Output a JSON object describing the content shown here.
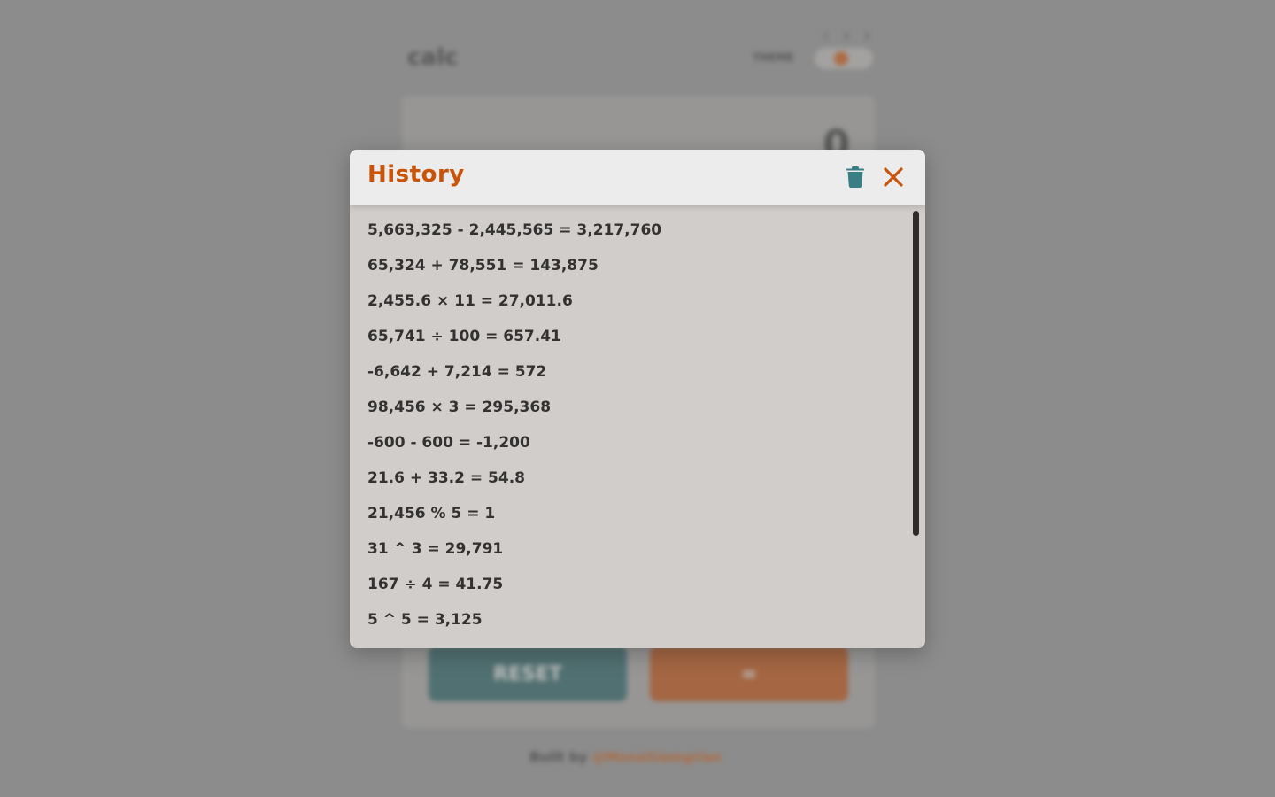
{
  "background": {
    "logo": "calc",
    "theme_label": "THEME",
    "theme_numbers": [
      "1",
      "2",
      "3"
    ],
    "display_value": "0",
    "reset_label": "RESET",
    "equals_label": "=",
    "footer_prefix": "Built by",
    "footer_author": "@MonaSiamgrian"
  },
  "modal": {
    "title": "History",
    "trash_icon": "trash-icon",
    "close_icon": "close-icon",
    "items": [
      "5,663,325 - 2,445,565 = 3,217,760",
      "65,324 + 78,551 = 143,875",
      "2,455.6 × 11 = 27,011.6",
      "65,741 ÷ 100 = 657.41",
      "-6,642 + 7,214 = 572",
      "98,456 × 3 = 295,368",
      "-600 - 600 = -1,200",
      "21.6 + 33.2 = 54.8",
      "21,456 % 5 = 1",
      "31 ^ 3 = 29,791",
      "167 ÷ 4 = 41.75",
      "5 ^ 5 = 3,125"
    ]
  },
  "colors": {
    "accent": "#c95409",
    "trash": "#3b7f84",
    "modal_bg": "#d1cdcb",
    "header_bg": "#ececec",
    "overlay": "#8c8c8c"
  }
}
